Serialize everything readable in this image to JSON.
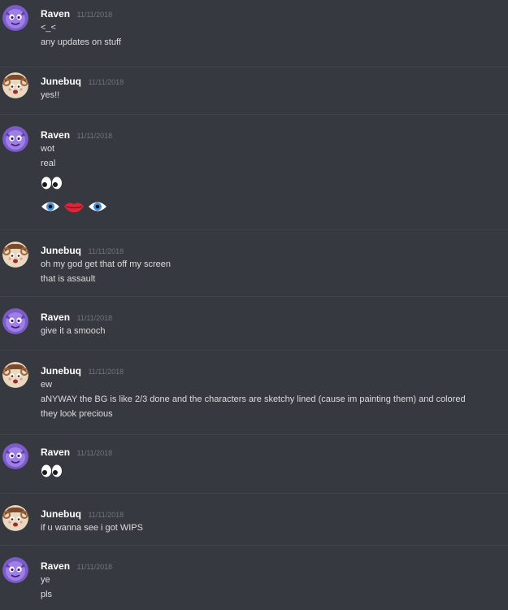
{
  "messages": [
    {
      "author": "Raven",
      "timestamp": "11/11/2018",
      "avatar_icon": "purple-creature-avatar",
      "lines": [
        "<_<",
        "any updates on stuff"
      ]
    },
    {
      "author": "Junebuq",
      "timestamp": "11/11/2018",
      "avatar_icon": "ram-girl-avatar",
      "lines": [
        "yes!!"
      ]
    },
    {
      "author": "Raven",
      "timestamp": "11/11/2018",
      "avatar_icon": "purple-creature-avatar",
      "lines": [
        "wot",
        "real"
      ],
      "emoji_rows": [
        [
          "eyes-emoji"
        ],
        [
          "eye-emoji",
          "lips-emoji",
          "eye-emoji"
        ]
      ]
    },
    {
      "author": "Junebuq",
      "timestamp": "11/11/2018",
      "avatar_icon": "ram-girl-avatar",
      "lines": [
        "oh my god get that off my screen",
        "that is assault"
      ]
    },
    {
      "author": "Raven",
      "timestamp": "11/11/2018",
      "avatar_icon": "purple-creature-avatar",
      "lines": [
        "give it a smooch"
      ]
    },
    {
      "author": "Junebuq",
      "timestamp": "11/11/2018",
      "avatar_icon": "ram-girl-avatar",
      "lines": [
        "ew",
        "aNYWAY the BG is like 2/3 done and the characters are sketchy lined (cause im painting them) and colored",
        "they look precious"
      ]
    },
    {
      "author": "Raven",
      "timestamp": "11/11/2018",
      "avatar_icon": "purple-creature-avatar",
      "lines": [],
      "emoji_rows": [
        [
          "eyes-emoji"
        ]
      ]
    },
    {
      "author": "Junebuq",
      "timestamp": "11/11/2018",
      "avatar_icon": "ram-girl-avatar",
      "lines": [
        "if u wanna see i got WIPS"
      ]
    },
    {
      "author": "Raven",
      "timestamp": "11/11/2018",
      "avatar_icon": "purple-creature-avatar",
      "lines": [
        "ye",
        "pls"
      ]
    }
  ],
  "colors": {
    "background": "#36393f",
    "author": "#ffffff",
    "timestamp": "#72767d",
    "message_text": "#dcddde",
    "divider": "#40434a"
  }
}
